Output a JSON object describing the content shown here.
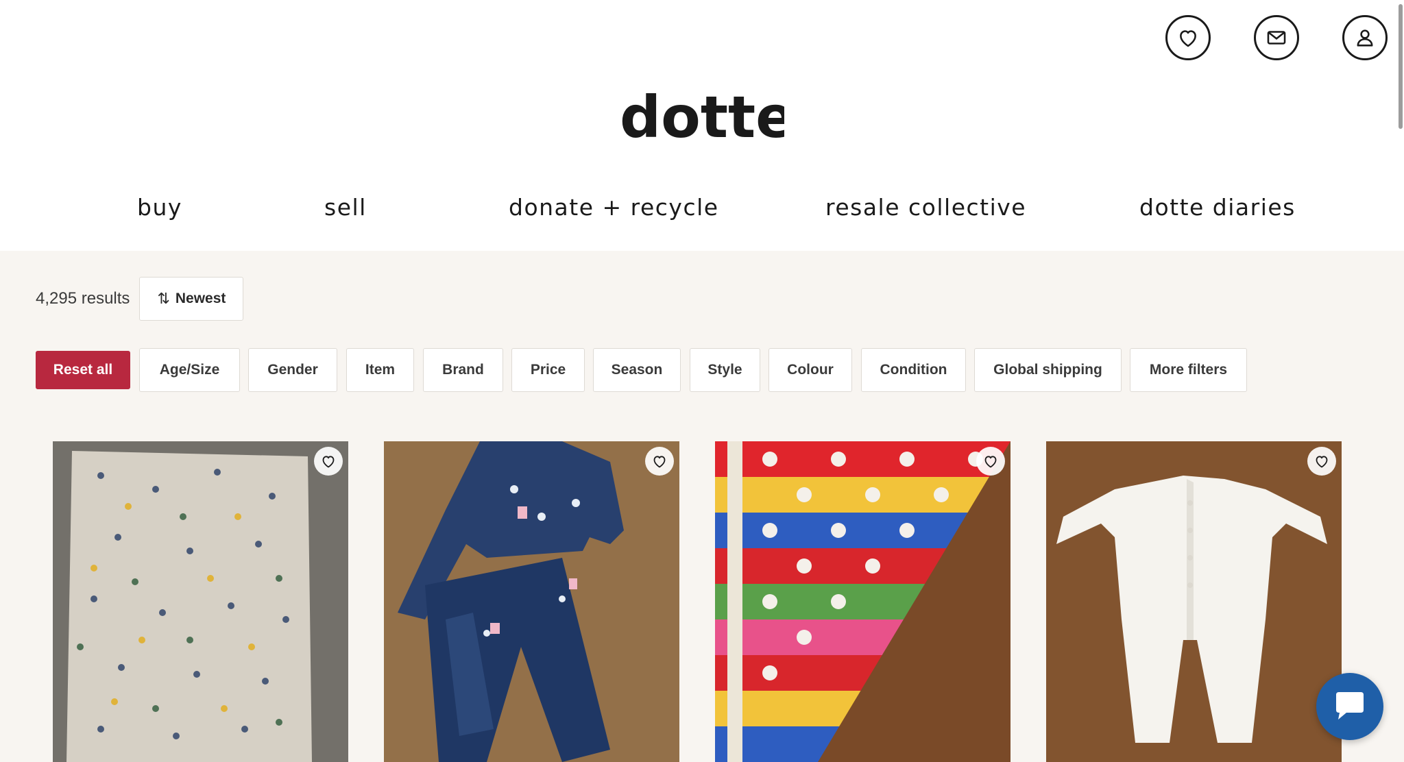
{
  "brand": {
    "logo_text": "dotte"
  },
  "header_icons": [
    {
      "name": "wishlist-heart-icon"
    },
    {
      "name": "messages-envelope-icon"
    },
    {
      "name": "account-user-icon"
    }
  ],
  "nav": {
    "items": [
      {
        "label": "buy"
      },
      {
        "label": "sell"
      },
      {
        "label": "donate + recycle"
      },
      {
        "label": "resale collective"
      },
      {
        "label": "dotte diaries"
      }
    ]
  },
  "results": {
    "count_text": "4,295 results",
    "sort_label": "Newest",
    "sort_icon": "sort-arrows-icon"
  },
  "filters": {
    "reset_label": "Reset all",
    "items": [
      {
        "label": "Age/Size"
      },
      {
        "label": "Gender"
      },
      {
        "label": "Item"
      },
      {
        "label": "Brand"
      },
      {
        "label": "Price"
      },
      {
        "label": "Season"
      },
      {
        "label": "Style"
      },
      {
        "label": "Colour"
      },
      {
        "label": "Condition"
      },
      {
        "label": "Global shipping"
      },
      {
        "label": "More filters"
      }
    ]
  },
  "products": [
    {
      "image": "grey dinosaur-print blanket on concrete",
      "favorite_icon": "heart-outline-icon"
    },
    {
      "image": "denim jacket and jeans set with gem patches",
      "favorite_icon": "heart-outline-icon"
    },
    {
      "image": "rainbow striped polka-dot knit blanket",
      "favorite_icon": "heart-outline-icon"
    },
    {
      "image": "white baby footed sleepsuit on wooden table",
      "favorite_icon": "heart-outline-icon"
    }
  ],
  "colors": {
    "accent": "#b8283f",
    "page_background": "#f8f5f1",
    "chat_button": "#1f5fa8"
  },
  "chat": {
    "icon": "chat-bubble-icon"
  }
}
